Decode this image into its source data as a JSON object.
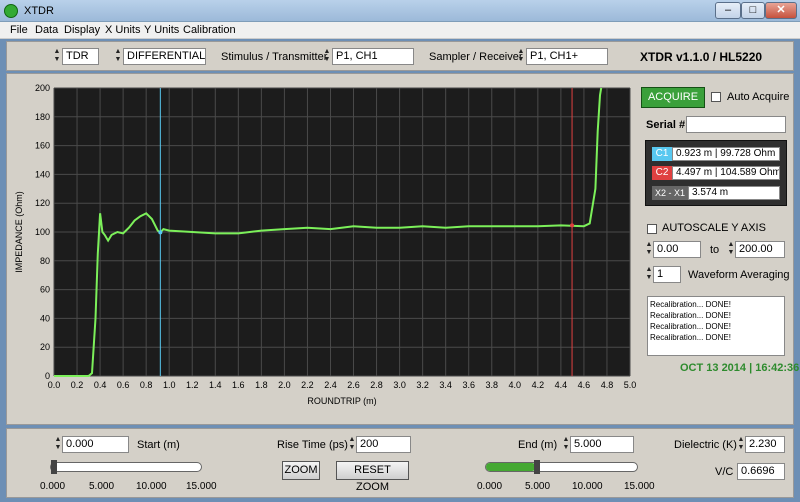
{
  "window": {
    "title": "XTDR"
  },
  "menu": [
    "File",
    "Data",
    "Display",
    "X Units",
    "Y Units",
    "Calibration"
  ],
  "toolbar": {
    "mode": "TDR",
    "measurement": "DIFFERENTIAL",
    "stimulus_label": "Stimulus / Transmitter",
    "stimulus_value": "P1, CH1",
    "sampler_label": "Sampler / Receiver",
    "sampler_value": "P1, CH1+",
    "brand": "XTDR v1.1.0 / HL5220"
  },
  "right": {
    "acquire_label": "ACQUIRE",
    "auto_acquire_label": "Auto Acquire",
    "serial_label": "Serial #",
    "serial_value": "",
    "c1_tag": "C1",
    "c1_value": "0.923 m  |  99.728 Ohm",
    "c2_tag": "C2",
    "c2_value": "4.497 m  |  104.589 Ohm",
    "dx_tag": "X2 - X1",
    "dx_value": "3.574 m",
    "autoscale_label": "AUTOSCALE Y AXIS",
    "ymin": "0.00",
    "to_label": "to",
    "ymax": "200.00",
    "avg_value": "1",
    "avg_label": "Waveform Averaging",
    "log": [
      "Recalibration... DONE!",
      "Recalibration... DONE!",
      "Recalibration... DONE!",
      "Recalibration... DONE!"
    ],
    "datetime": "OCT 13 2014 | 16:42:36"
  },
  "bottom": {
    "start_value": "0.000",
    "start_label": "Start (m)",
    "start_ticks": [
      "0.000",
      "5.000",
      "10.000",
      "15.000"
    ],
    "start_fraction": 0.0,
    "rise_label": "Rise Time (ps)",
    "rise_value": "200",
    "zoom_label": "ZOOM",
    "reset_zoom_label": "RESET ZOOM",
    "end_label": "End (m)",
    "end_value": "5.000",
    "end_ticks": [
      "0.000",
      "5.000",
      "10.000",
      "15.000"
    ],
    "end_fraction": 0.333,
    "dielectric_label": "Dielectric (K)",
    "dielectric_value": "2.230",
    "vc_label": "V/C",
    "vc_value": "0.6696"
  },
  "colors": {
    "trace": "#7cf05a",
    "cursor1": "#58c8f0",
    "cursor2": "#e04040",
    "plot_bg": "#1c1c1c",
    "grid": "#4a4a4a"
  },
  "chart_data": {
    "type": "line",
    "title": "",
    "xlabel": "ROUNDTRIP (m)",
    "ylabel": "IMPEDANCE (Ohm)",
    "xlim": [
      0,
      5
    ],
    "ylim": [
      0,
      200
    ],
    "x_ticks": [
      "0.0",
      "0.2",
      "0.4",
      "0.6",
      "0.8",
      "1.0",
      "1.2",
      "1.4",
      "1.6",
      "1.8",
      "2.0",
      "2.2",
      "2.4",
      "2.6",
      "2.8",
      "3.0",
      "3.2",
      "3.4",
      "3.6",
      "3.8",
      "4.0",
      "4.2",
      "4.4",
      "4.6",
      "4.8",
      "5.0"
    ],
    "y_ticks": [
      "0",
      "20",
      "40",
      "60",
      "80",
      "100",
      "120",
      "140",
      "160",
      "180",
      "200"
    ],
    "grid": true,
    "cursors": [
      {
        "x": 0.923
      },
      {
        "x": 4.497
      }
    ],
    "series": [
      {
        "x": [
          0.0,
          0.3,
          0.33,
          0.36,
          0.38,
          0.4,
          0.42,
          0.44,
          0.47,
          0.5,
          0.55,
          0.6,
          0.65,
          0.7,
          0.75,
          0.8,
          0.85,
          0.9,
          0.923,
          0.95,
          1.0,
          1.2,
          1.4,
          1.6,
          1.8,
          2.0,
          2.2,
          2.4,
          2.6,
          2.8,
          3.0,
          3.2,
          3.4,
          3.6,
          3.8,
          4.0,
          4.2,
          4.4,
          4.6,
          4.65,
          4.7,
          4.72,
          4.74,
          4.75
        ],
        "y": [
          0,
          0,
          2,
          40,
          85,
          113,
          100,
          98,
          94,
          98,
          100,
          99,
          103,
          108,
          111,
          113,
          109,
          101,
          99.7,
          102,
          101,
          100,
          99,
          99,
          101,
          102,
          103,
          102,
          104,
          103,
          103,
          104,
          103,
          104,
          104,
          104,
          104,
          104.6,
          104,
          106,
          130,
          170,
          195,
          200
        ]
      }
    ]
  }
}
